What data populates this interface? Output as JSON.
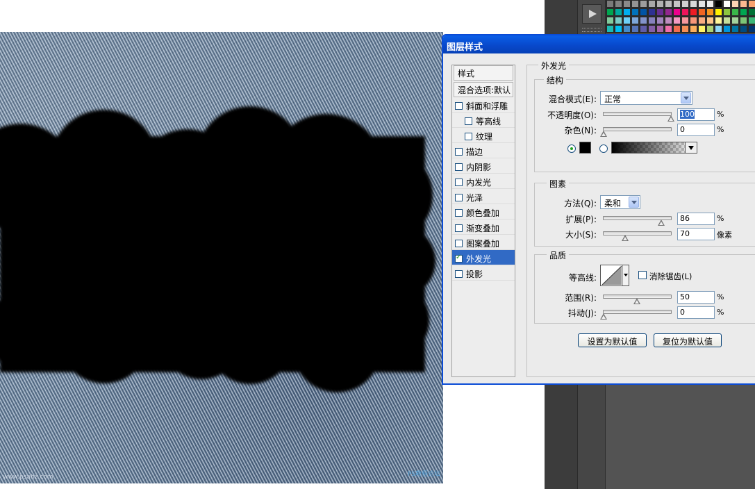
{
  "canvas": {
    "watermark_left": "www.psahz.com",
    "watermark_right": "PS教程论坛"
  },
  "swatch_colors": [
    "#7a7a7a",
    "#828282",
    "#8a8a8a",
    "#949494",
    "#9d9d9d",
    "#a7a7a7",
    "#b1b1b1",
    "#bbbbbb",
    "#c5c5c5",
    "#cfcfcf",
    "#d9d9d9",
    "#e3e3e3",
    "#ededed",
    "#000000",
    "#ffffff",
    "#fcd2b4",
    "#fbb890",
    "#f9a26f",
    "#00a650",
    "#00a99d",
    "#00aeef",
    "#0072bc",
    "#0054a6",
    "#2e3192",
    "#662d91",
    "#92278f",
    "#ec008c",
    "#ed145b",
    "#ed1c24",
    "#f26522",
    "#f7941d",
    "#fff200",
    "#8dc63f",
    "#39b54a",
    "#00a651",
    "#007236",
    "#82ca9c",
    "#7accc8",
    "#6dcff6",
    "#7da7d9",
    "#8393ca",
    "#8781bd",
    "#a186be",
    "#bd8cbf",
    "#f49ac2",
    "#f6989d",
    "#f69679",
    "#f9ad81",
    "#fdc689",
    "#fff799",
    "#c4df9b",
    "#a3d39c",
    "#7cc576",
    "#3cb878",
    "#1cbbb4",
    "#00bff3",
    "#448ccb",
    "#5574b9",
    "#605ca8",
    "#855fa8",
    "#a864a8",
    "#f06eaa",
    "#f26c4f",
    "#f68e56",
    "#fbaf5d",
    "#fff467",
    "#acd373",
    "#8ed8f8",
    "#0095da",
    "#0076a3",
    "#004b80",
    "#003471"
  ],
  "dialog": {
    "title": "图层样式",
    "styles_header": "样式",
    "blend_options": "混合选项:默认",
    "items": [
      {
        "label": "斜面和浮雕",
        "checked": false,
        "indent": false,
        "selected": false
      },
      {
        "label": "等高线",
        "checked": false,
        "indent": true,
        "selected": false
      },
      {
        "label": "纹理",
        "checked": false,
        "indent": true,
        "selected": false
      },
      {
        "label": "描边",
        "checked": false,
        "indent": false,
        "selected": false
      },
      {
        "label": "内阴影",
        "checked": false,
        "indent": false,
        "selected": false
      },
      {
        "label": "内发光",
        "checked": false,
        "indent": false,
        "selected": false
      },
      {
        "label": "光泽",
        "checked": false,
        "indent": false,
        "selected": false
      },
      {
        "label": "颜色叠加",
        "checked": false,
        "indent": false,
        "selected": false
      },
      {
        "label": "渐变叠加",
        "checked": false,
        "indent": false,
        "selected": false
      },
      {
        "label": "图案叠加",
        "checked": false,
        "indent": false,
        "selected": false
      },
      {
        "label": "外发光",
        "checked": true,
        "indent": false,
        "selected": true
      },
      {
        "label": "投影",
        "checked": false,
        "indent": false,
        "selected": false
      }
    ],
    "panel_title": "外发光",
    "structure": {
      "title": "结构",
      "blend_mode_label": "混合模式(E):",
      "blend_mode_value": "正常",
      "opacity_label": "不透明度(O):",
      "opacity_value": "100",
      "noise_label": "杂色(N):",
      "noise_value": "0",
      "percent": "%",
      "color_swatch": "#000000"
    },
    "elements": {
      "title": "图素",
      "technique_label": "方法(Q):",
      "technique_value": "柔和",
      "spread_label": "扩展(P):",
      "spread_value": "86",
      "size_label": "大小(S):",
      "size_value": "70",
      "percent": "%",
      "px_unit": "像素"
    },
    "quality": {
      "title": "品质",
      "contour_label": "等高线:",
      "antialias_label": "消除锯齿(L)",
      "range_label": "范围(R):",
      "range_value": "50",
      "jitter_label": "抖动(J):",
      "jitter_value": "0",
      "percent": "%"
    },
    "buttons": {
      "make_default": "设置为默认值",
      "reset_default": "复位为默认值"
    }
  }
}
